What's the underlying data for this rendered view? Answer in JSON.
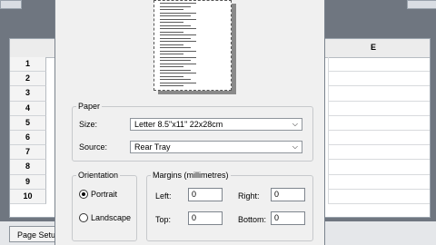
{
  "spreadsheet": {
    "column_header": "E",
    "row_numbers": [
      "1",
      "2",
      "3",
      "4",
      "5",
      "6",
      "7",
      "8",
      "9",
      "10"
    ],
    "bottom_tab_label": "Page Setu"
  },
  "dialog": {
    "paper": {
      "legend": "Paper",
      "size_label": "Size:",
      "size_value": "Letter 8.5\"x11\" 22x28cm",
      "source_label": "Source:",
      "source_value": "Rear Tray"
    },
    "orientation": {
      "legend": "Orientation",
      "portrait_label": "Portrait",
      "landscape_label": "Landscape",
      "selected": "Portrait"
    },
    "margins": {
      "legend": "Margins (millimetres)",
      "left_label": "Left:",
      "left_value": "0",
      "right_label": "Right:",
      "right_value": "0",
      "top_label": "Top:",
      "top_value": "0",
      "bottom_label": "Bottom:",
      "bottom_value": "0"
    }
  },
  "icons": {
    "dropdown": "chevron-down-icon"
  },
  "colors": {
    "background": "#6f7680",
    "dialog": "#f0f0f0"
  }
}
